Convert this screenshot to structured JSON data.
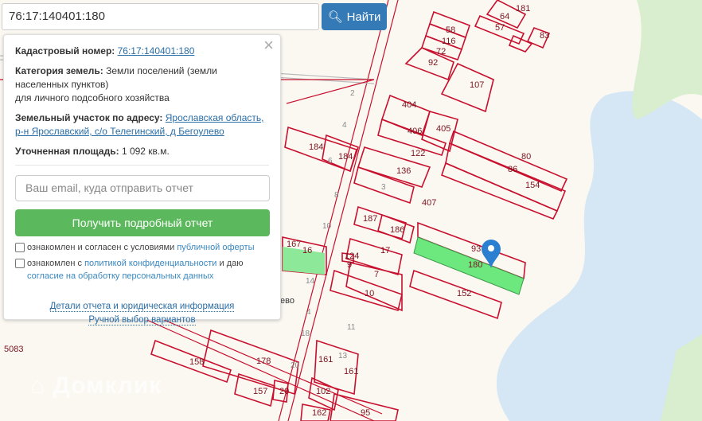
{
  "search": {
    "value": "76:17:140401:180",
    "button": "Найти",
    "icon": "search-icon"
  },
  "panel": {
    "cadastral_label": "Кадастровый номер:",
    "cadastral_value": "76:17:140401:180",
    "category_label": "Категория земель:",
    "category_value": "Земли поселений (земли населенных пунктов)",
    "category_use": "для личного подсобного хозяйства",
    "address_label": "Земельный участок по адресу:",
    "address_value": "Ярославская область, р-н Ярославский, с/о Телегинский, д Бегоулево",
    "area_label": "Уточненная площадь:",
    "area_value": "1 092 кв.м.",
    "email_placeholder": "Ваш email, куда отправить отчет",
    "report_button": "Получить подробный отчет",
    "check1_text": "ознакомлен и согласен с условиями ",
    "check1_link": "публичной оферты",
    "check2_text": "ознакомлен с ",
    "check2_link": "политикой конфиденциальности",
    "check2_text2": " и даю ",
    "check2_link2": "согласие на обработку персональных данных",
    "details_link": "Детали отчета и юридическая информация",
    "manual_link": "Ручной выбор вариантов"
  },
  "map": {
    "parcel_labels": [
      "181",
      "64",
      "57",
      "83",
      "58",
      "116",
      "72",
      "92",
      "107",
      "404",
      "406",
      "405",
      "122",
      "80",
      "86",
      "154",
      "184",
      "184",
      "136",
      "407",
      "187",
      "186",
      "93",
      "180",
      "152",
      "167",
      "17",
      "7",
      "10",
      "124",
      "158",
      "178",
      "157",
      "20",
      "161",
      "161",
      "102",
      "95",
      "162",
      "2",
      "4",
      "6",
      "8",
      "10",
      "14",
      "4",
      "18",
      "11",
      "13",
      "20",
      "3",
      "5083",
      "9",
      "16"
    ],
    "village_label": "ево",
    "watermark": "Домклик",
    "colors": {
      "parcel": "#c8102e",
      "selected": "#6de87e",
      "water": "#d5e7f5",
      "green": "#d8eecf",
      "marker": "#2b7fd1"
    }
  }
}
